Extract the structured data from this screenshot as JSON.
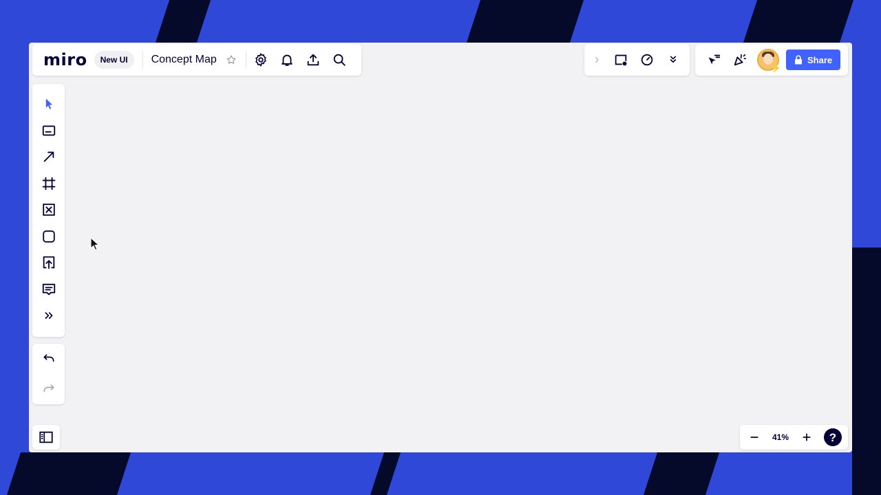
{
  "app": {
    "logo": "miro",
    "badge": "New UI",
    "board_title": "Concept Map"
  },
  "header_left_icons": [
    "star-icon",
    "settings-icon",
    "bell-icon",
    "export-icon",
    "search-icon"
  ],
  "header_center_icons": [
    "chevron-right-icon",
    "frame-presentation-icon",
    "timer-icon",
    "double-chevron-down-icon"
  ],
  "header_right": {
    "icons": [
      "cursor-filter-icon",
      "celebrate-icon"
    ],
    "share_label": "Share"
  },
  "toolbar_tools": [
    "select",
    "text",
    "line-arrow",
    "frame",
    "sticky-cross",
    "shape",
    "upload",
    "comment",
    "more"
  ],
  "undo_redo": [
    "undo",
    "redo"
  ],
  "zoom": {
    "value": "41%"
  },
  "colors": {
    "background": "#2f48d8",
    "stripes": "#050a2b",
    "canvas": "#f2f2f4",
    "accent": "#4262ff",
    "text": "#050038"
  }
}
